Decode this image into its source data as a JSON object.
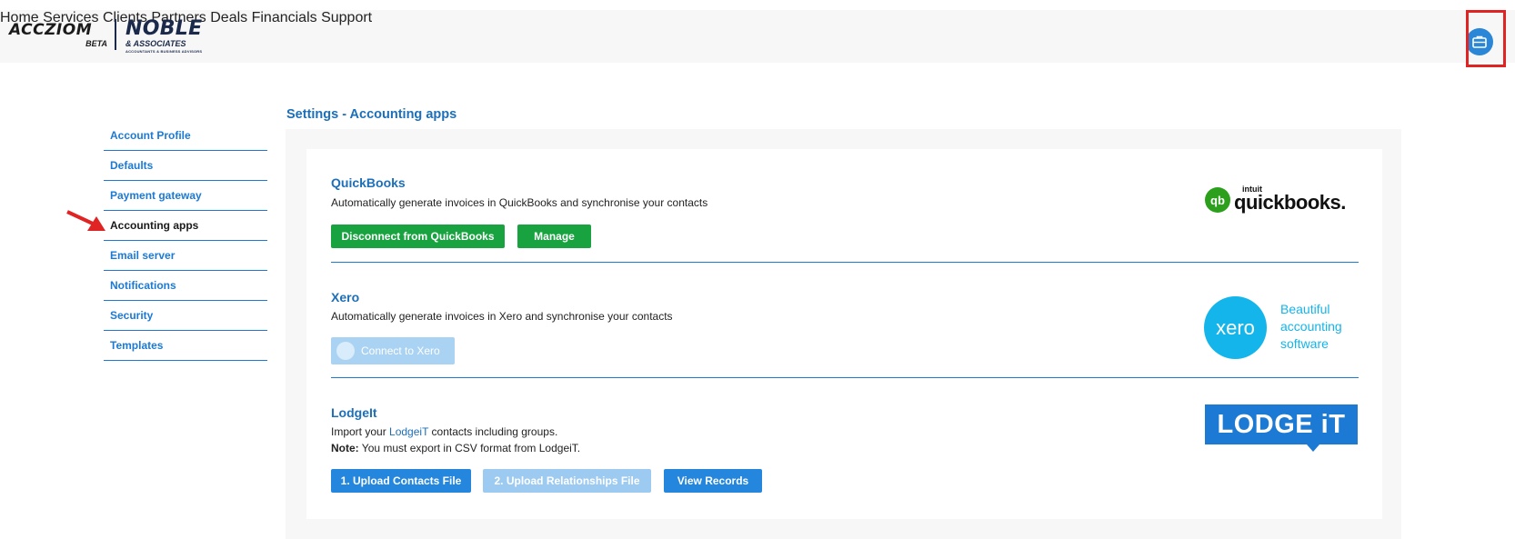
{
  "brand": {
    "logo_main": "ACCZIOM",
    "logo_beta": "BETA",
    "logo_partner": "NOBLE",
    "logo_partner_sub": "& ASSOCIATES",
    "logo_partner_tagline": "ACCOUNTANTS & BUSINESS ADVISORS"
  },
  "nav": {
    "items": [
      "Home",
      "Services",
      "Clients",
      "Partners",
      "Deals",
      "Financials",
      "Support"
    ],
    "profile_icon": "briefcase-icon"
  },
  "sidebar": {
    "items": [
      {
        "label": "Account Profile"
      },
      {
        "label": "Defaults"
      },
      {
        "label": "Payment gateway"
      },
      {
        "label": "Accounting apps"
      },
      {
        "label": "Email server"
      },
      {
        "label": "Notifications"
      },
      {
        "label": "Security"
      },
      {
        "label": "Templates"
      }
    ],
    "active": "Accounting apps"
  },
  "page": {
    "title": "Settings - Accounting apps"
  },
  "quickbooks": {
    "title": "QuickBooks",
    "description": "Automatically generate invoices in QuickBooks and synchronise your contacts",
    "disconnect_label": "Disconnect from QuickBooks",
    "manage_label": "Manage",
    "logo_circle": "qb",
    "logo_intuit": "intuit",
    "logo_word": "quickbooks."
  },
  "xero": {
    "title": "Xero",
    "description": "Automatically generate invoices in Xero and synchronise your contacts",
    "connect_label": "Connect to Xero",
    "logo_word": "xero",
    "logo_tagline": "Beautiful accounting software"
  },
  "lodgeit": {
    "title": "LodgeIt",
    "description_prefix": "Import your",
    "description_link": "LodgeiT",
    "description_suffix": "contacts including groups.",
    "note_label": "Note:",
    "note_text": "You must export in CSV format from LodgeiT.",
    "upload_contacts_label": "1. Upload Contacts File",
    "upload_relationships_label": "2. Upload Relationships File",
    "view_records_label": "View Records",
    "logo_word": "LODGE iT"
  },
  "colors": {
    "accent_blue": "#1c7ad4",
    "title_blue": "#1c6fb8",
    "green": "#19a340",
    "annotation_red": "#e02424"
  }
}
